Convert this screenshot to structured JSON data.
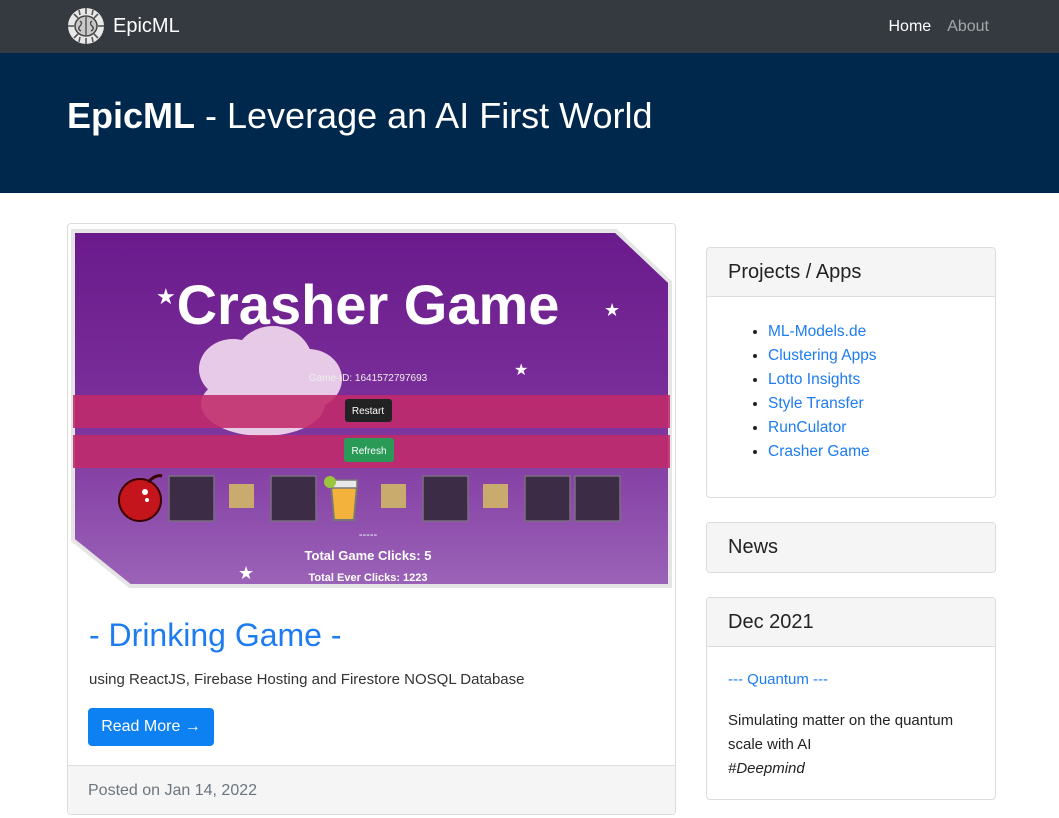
{
  "navbar": {
    "brand": "EpicML",
    "links": [
      {
        "label": "Home",
        "active": true
      },
      {
        "label": "About",
        "active": false
      }
    ]
  },
  "hero": {
    "title_bold": "EpicML",
    "title_rest": " - Leverage an AI First World"
  },
  "post": {
    "image": {
      "heading": "Crasher Game",
      "game_id": "Game-ID: 1641572797693",
      "restart_label": "Restart",
      "refresh_label": "Refresh",
      "dashes": "-----",
      "total_game_clicks": "Total Game Clicks: 5",
      "total_ever_clicks": "Total Ever Clicks: 1223"
    },
    "title": "- Drinking Game -",
    "text": "using ReactJS, Firebase Hosting and Firestore NOSQL Database",
    "read_more": "Read More →",
    "date": "Posted on Jan 14, 2022"
  },
  "sidebar": {
    "projects": {
      "header": "Projects / Apps",
      "items": [
        "ML-Models.de",
        "Clustering Apps",
        "Lotto Insights",
        "Style Transfer",
        "RunCulator",
        "Crasher Game"
      ]
    },
    "news": {
      "header": "News"
    },
    "dec": {
      "header": "Dec 2021",
      "link": "--- Quantum ---",
      "text": "Simulating matter on the quantum scale with AI",
      "tag": "#Deepmind"
    }
  },
  "colors": {
    "navbar": "#343a40",
    "hero": "#00284d",
    "link": "#1e7cf0",
    "button": "#0d80f2"
  }
}
